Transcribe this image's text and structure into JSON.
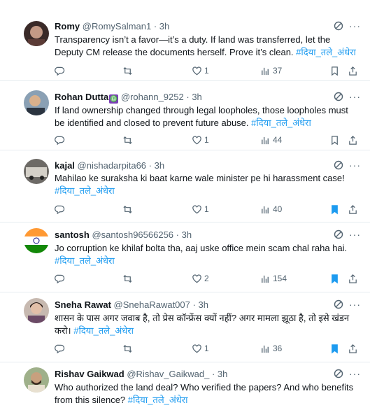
{
  "tweets": [
    {
      "name": "Romy",
      "handle": "@RomySalman1",
      "time": "3h",
      "text": "Transparency isn’t a favor—it’s a duty. If land was transferred, let the Deputy CM release the documents herself. Prove it’s clean.",
      "hashtag": "#दिया_तले_अंधेरा",
      "replies": "",
      "reposts": "",
      "likes": "1",
      "views": "37",
      "bookmarked": false
    },
    {
      "name": "Rohan Dutta",
      "badge": "♎",
      "handle": "@rohann_9252",
      "time": "3h",
      "text": "If land ownership changed through legal loopholes, those loopholes must be identified and closed to prevent future abuse.",
      "hashtag": "#दिया_तले_अंधेरा",
      "replies": "",
      "reposts": "",
      "likes": "1",
      "views": "44",
      "bookmarked": false
    },
    {
      "name": "kajal",
      "handle": "@nishadarpita66",
      "time": "3h",
      "text": "Mahilao ke suraksha ki baat karne wale minister pe hi harassment case!",
      "hashtag": "#दिया_तले_अंधेरा",
      "replies": "",
      "reposts": "",
      "likes": "1",
      "views": "40",
      "bookmarked": true
    },
    {
      "name": "santosh",
      "handle": "@santosh96566256",
      "time": "3h",
      "text": "Jo corruption ke khilaf bolta tha, aaj uske office mein scam chal raha hai.",
      "hashtag": "#दिया_तले_अंधेरा",
      "replies": "",
      "reposts": "",
      "likes": "2",
      "views": "154",
      "bookmarked": true
    },
    {
      "name": "Sneha Rawat",
      "handle": "@SnehaRawat007",
      "time": "3h",
      "text": "शासन के पास अगर जवाब है, तो प्रेस कॉन्फ्रेंस क्यों नहीं? अगर मामला झूठा है, तो इसे खंडन करो।",
      "hashtag": "#दिया_तले_अंधेरा",
      "replies": "",
      "reposts": "",
      "likes": "1",
      "views": "36",
      "bookmarked": true
    },
    {
      "name": "Rishav Gaikwad",
      "handle": "@Rishav_Gaikwad_",
      "time": "3h",
      "text": "Who authorized the land deal? Who verified the papers? And who benefits from this silence?",
      "hashtag": "#दिया_तले_अंधेरा"
    }
  ],
  "colors": {
    "link": "#1d9bf0",
    "muted": "#536471",
    "text": "#0f1419",
    "divider": "#e6ecf0"
  },
  "icons": [
    "reply-icon",
    "repost-icon",
    "like-icon",
    "views-icon",
    "bookmark-icon",
    "share-icon",
    "grok-icon",
    "more-icon"
  ]
}
